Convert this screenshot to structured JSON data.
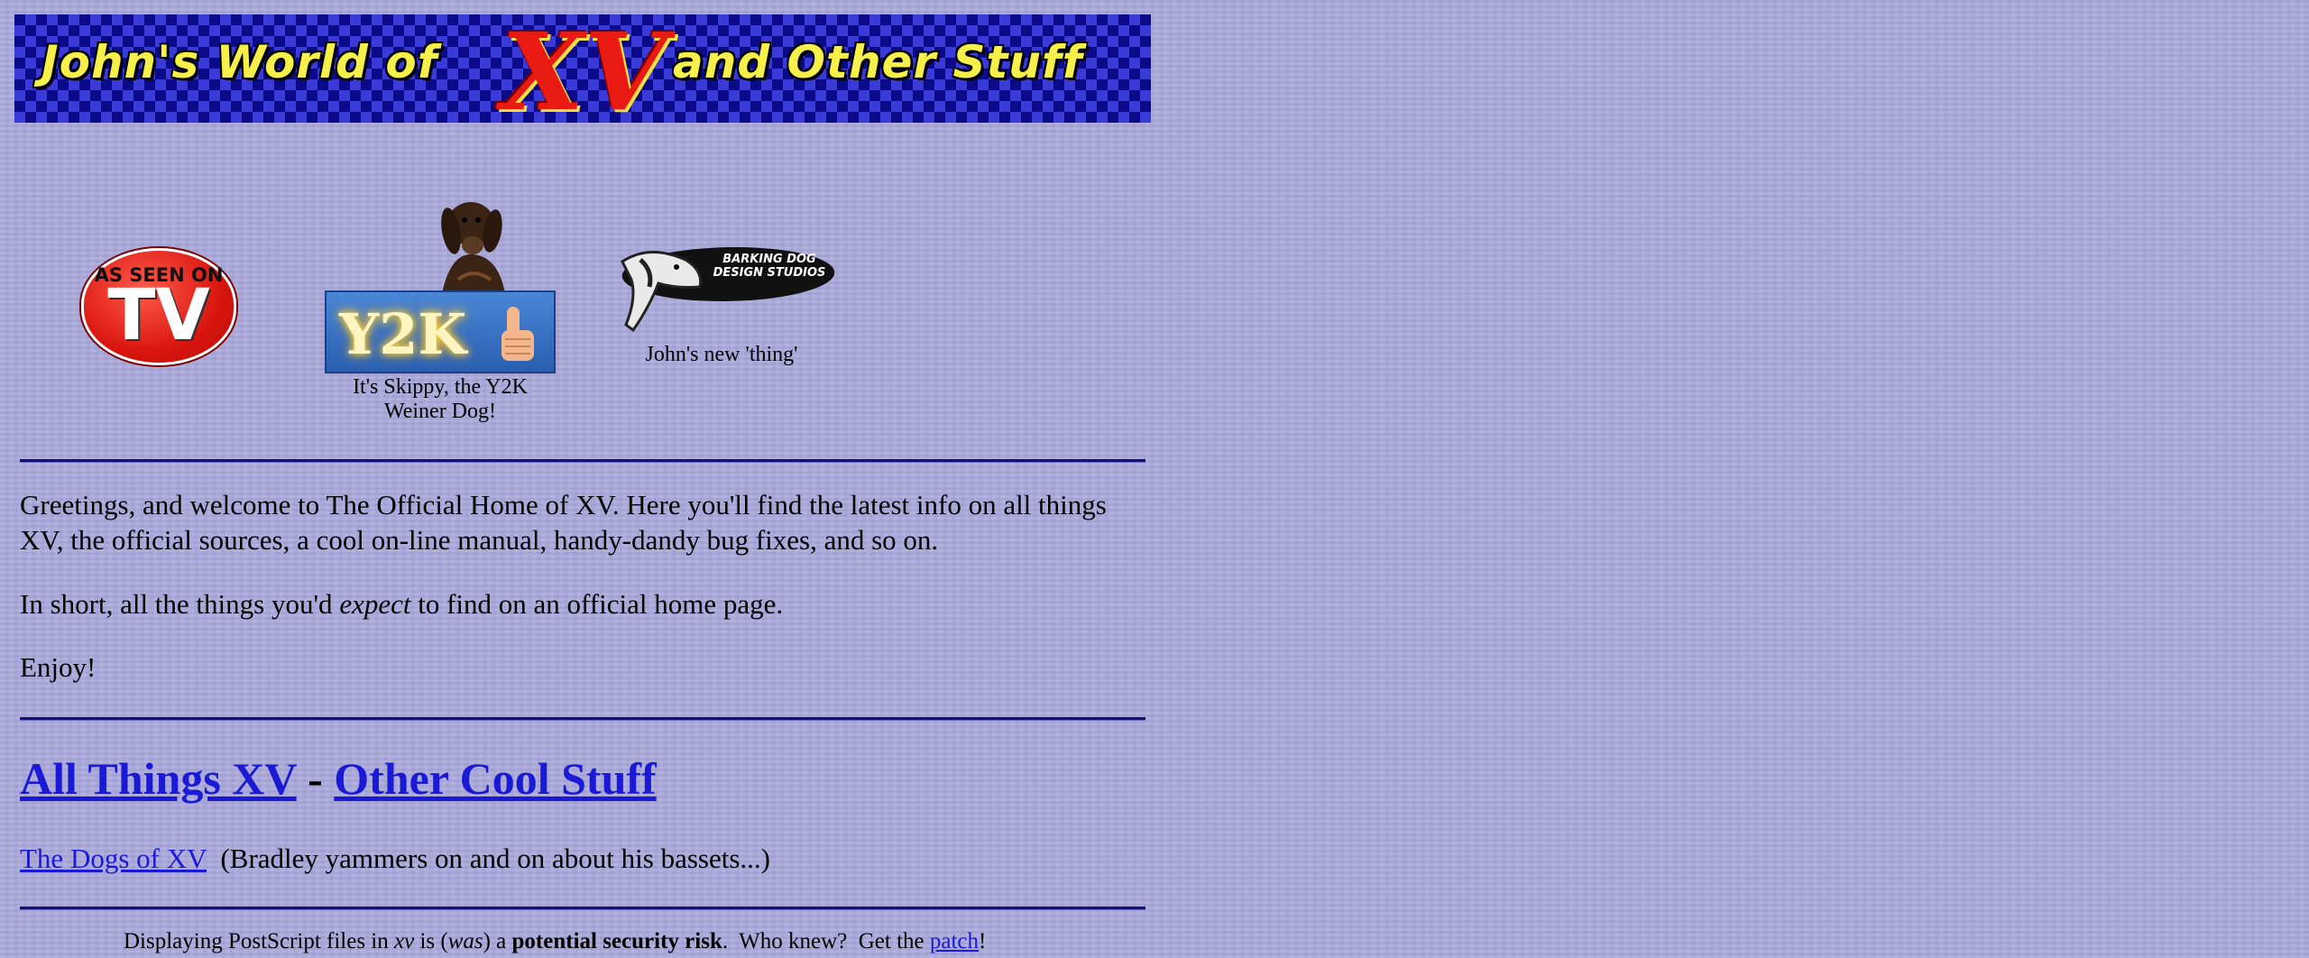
{
  "banner": {
    "left_text": "John's World of",
    "xv_text": "XV",
    "right_text": "and Other Stuff",
    "colors": {
      "text": "#f7f04a",
      "xv": "#e91a12",
      "check_dark": "#0b0b8a",
      "check_light": "#3a3ad8"
    }
  },
  "badges": {
    "tv": {
      "top": "AS SEEN ON",
      "big": "TV"
    },
    "y2k": {
      "text": "Y2K",
      "caption": "It's Skippy, the Y2K Weiner Dog!"
    },
    "barking": {
      "logo_text": "BARKING DOG DESIGN STUDIOS",
      "caption": "John's new 'thing'"
    }
  },
  "intro": {
    "greeting": "Greetings, and welcome to The Official Home of XV. Here you'll find the latest info on all things XV, the official sources, a cool on-line manual, handy-dandy bug fixes, and so on.",
    "short_before": "In short, all the things you'd ",
    "short_em": "expect",
    "short_after": " to find on an official home page.",
    "enjoy": "Enjoy!"
  },
  "links": {
    "all_things": "All Things XV",
    "separator": " - ",
    "other": "Other Cool Stuff",
    "dogs_link": "The Dogs of XV",
    "dogs_desc": "  (Bradley yammers on and on about his bassets...)"
  },
  "notice": {
    "t1": "Displaying PostScript files in ",
    "xv": "xv",
    "t2": " is (",
    "was": "was",
    "t3": ") a ",
    "bold": "potential security risk",
    "t4": ".  Who knew?  Get the ",
    "patch": "patch",
    "t5": "!"
  },
  "colors": {
    "background": "#aaa9dc",
    "link": "#1a1ad6",
    "rule": "#10107a"
  }
}
